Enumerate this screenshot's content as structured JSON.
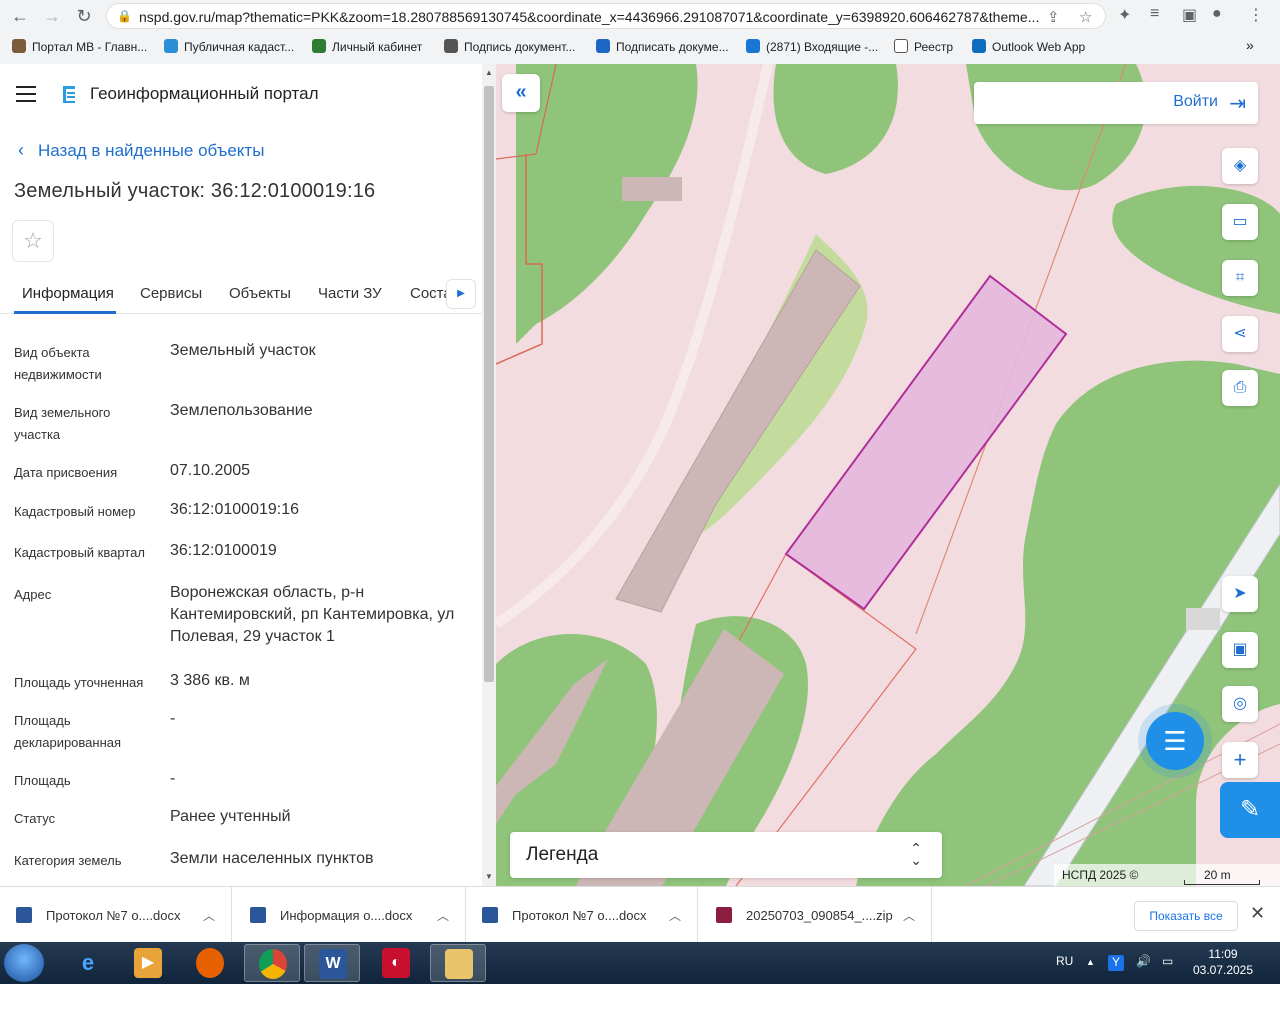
{
  "browser": {
    "url": "nspd.gov.ru/map?thematic=PKK&zoom=18.280788569130745&coordinate_x=4436966.291087071&coordinate_y=6398920.606462787&theme...",
    "bookmarks": [
      "Портал МВ - Главн...",
      "Публичная кадаст...",
      "Личный кабинет",
      "Подпись документ...",
      "Подписать докуме...",
      "(2871) Входящие -...",
      "Реестр",
      "Outlook Web App"
    ],
    "more_bookmarks": "»"
  },
  "panel": {
    "portal_title": "Геоинформационный портал",
    "back_link": "Назад в найденные объекты",
    "parcel_title": "Земельный участок: 36:12:0100019:16",
    "tabs": [
      "Информация",
      "Сервисы",
      "Объекты",
      "Части ЗУ",
      "Соста"
    ],
    "info": [
      {
        "label": "Вид объекта недвижимости",
        "value": "Земельный участок"
      },
      {
        "label": "Вид земельного участка",
        "value": "Землепользование"
      },
      {
        "label": "Дата присвоения",
        "value": "07.10.2005"
      },
      {
        "label": "Кадастровый номер",
        "value": "36:12:0100019:16"
      },
      {
        "label": "Кадастровый квартал",
        "value": "36:12:0100019"
      },
      {
        "label": "Адрес",
        "value": "Воронежская область, р-н Кантемировский, рп Кантемировка, ул Полевая, 29 участок 1"
      },
      {
        "label": "Площадь уточненная",
        "value": "3 386 кв. м"
      },
      {
        "label": "Площадь декларированная",
        "value": "-"
      },
      {
        "label": "Площадь",
        "value": "-"
      },
      {
        "label": "Статус",
        "value": "Ранее учтенный"
      },
      {
        "label": "Категория земель",
        "value": "Земли населенных пунктов"
      }
    ]
  },
  "map": {
    "login_label": "Войти",
    "legend_label": "Легенда",
    "attribution": "НСПД 2025 ©",
    "scale_label": "20 m",
    "colors": {
      "background": "#f3dce0",
      "vegetation": "#8fc47a",
      "parcel_fill": "#e6b7dd",
      "parcel_stroke": "#b0309a",
      "building": "#cdb7b6",
      "road": "#eef0f3"
    }
  },
  "downloads": {
    "items": [
      "Протокол №7 о....docx",
      "Информация о....docx",
      "Протокол №7 о....docx",
      "20250703_090854_....zip"
    ],
    "show_all": "Показать все"
  },
  "taskbar": {
    "lang": "RU",
    "time": "11:09",
    "date": "03.07.2025"
  }
}
